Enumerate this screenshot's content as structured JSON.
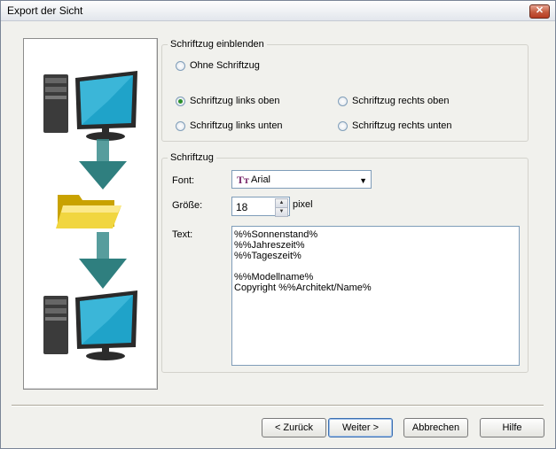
{
  "window": {
    "title": "Export der Sicht",
    "close_glyph": "✕"
  },
  "illustration": {
    "top_icon": "computer-monitor-icon",
    "middle_icon": "folder-icon",
    "bottom_icon": "computer-monitor-icon",
    "arrow_color": "#3a8c8c"
  },
  "group_display": {
    "legend": "Schriftzug einblenden",
    "options": {
      "none": "Ohne Schriftzug",
      "top_left": "Schriftzug links oben",
      "top_right": "Schriftzug rechts oben",
      "bottom_left": "Schriftzug links unten",
      "bottom_right": "Schriftzug rechts unten"
    },
    "selected": "top_left"
  },
  "group_text": {
    "legend": "Schriftzug",
    "font_label": "Font:",
    "font_value": "Arial",
    "font_icon_glyph": "Tт",
    "size_label": "Größe:",
    "size_value": "18",
    "size_unit": "pixel",
    "text_label": "Text:",
    "text_value": "%%Sonnenstand%\n%%Jahreszeit%\n%%Tageszeit%\n\n%%Modellname%\nCopyright %%Architekt/Name%"
  },
  "buttons": {
    "back": "< Zurück",
    "next": "Weiter >",
    "cancel": "Abbrechen",
    "help": "Hilfe"
  }
}
